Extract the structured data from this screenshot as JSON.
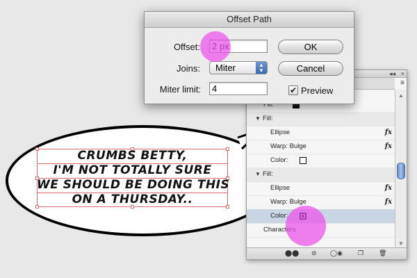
{
  "dialog": {
    "title": "Offset Path",
    "offset_label": "Offset:",
    "offset_value": "2 px",
    "joins_label": "Joins:",
    "joins_value": "Miter",
    "miter_label": "Miter limit:",
    "miter_value": "4",
    "ok_label": "OK",
    "cancel_label": "Cancel",
    "preview_label": "Preview",
    "preview_checked": "✔"
  },
  "panel": {
    "rows": [
      {
        "label": "Fill:"
      },
      {
        "label": "Fill:"
      },
      {
        "label": "Ellipse"
      },
      {
        "label": "Warp: Bulge"
      },
      {
        "label": "Color:"
      },
      {
        "label": "Fill:"
      },
      {
        "label": "Ellipse"
      },
      {
        "label": "Warp: Bulge"
      },
      {
        "label": "Color:"
      },
      {
        "label": "Characters"
      }
    ],
    "fx_symbol": "fx",
    "swatch_black": "#111111",
    "swatch_white": "#ffffff"
  },
  "bubble": {
    "lines": [
      "Crumbs Betty,",
      "I'm not totally sure",
      "we should be doing this",
      "on a Thursday.."
    ]
  },
  "colors": {
    "selection": "#e06a6a",
    "click_marker": "#eb50eb",
    "selected_row": "#c9d5e3"
  }
}
